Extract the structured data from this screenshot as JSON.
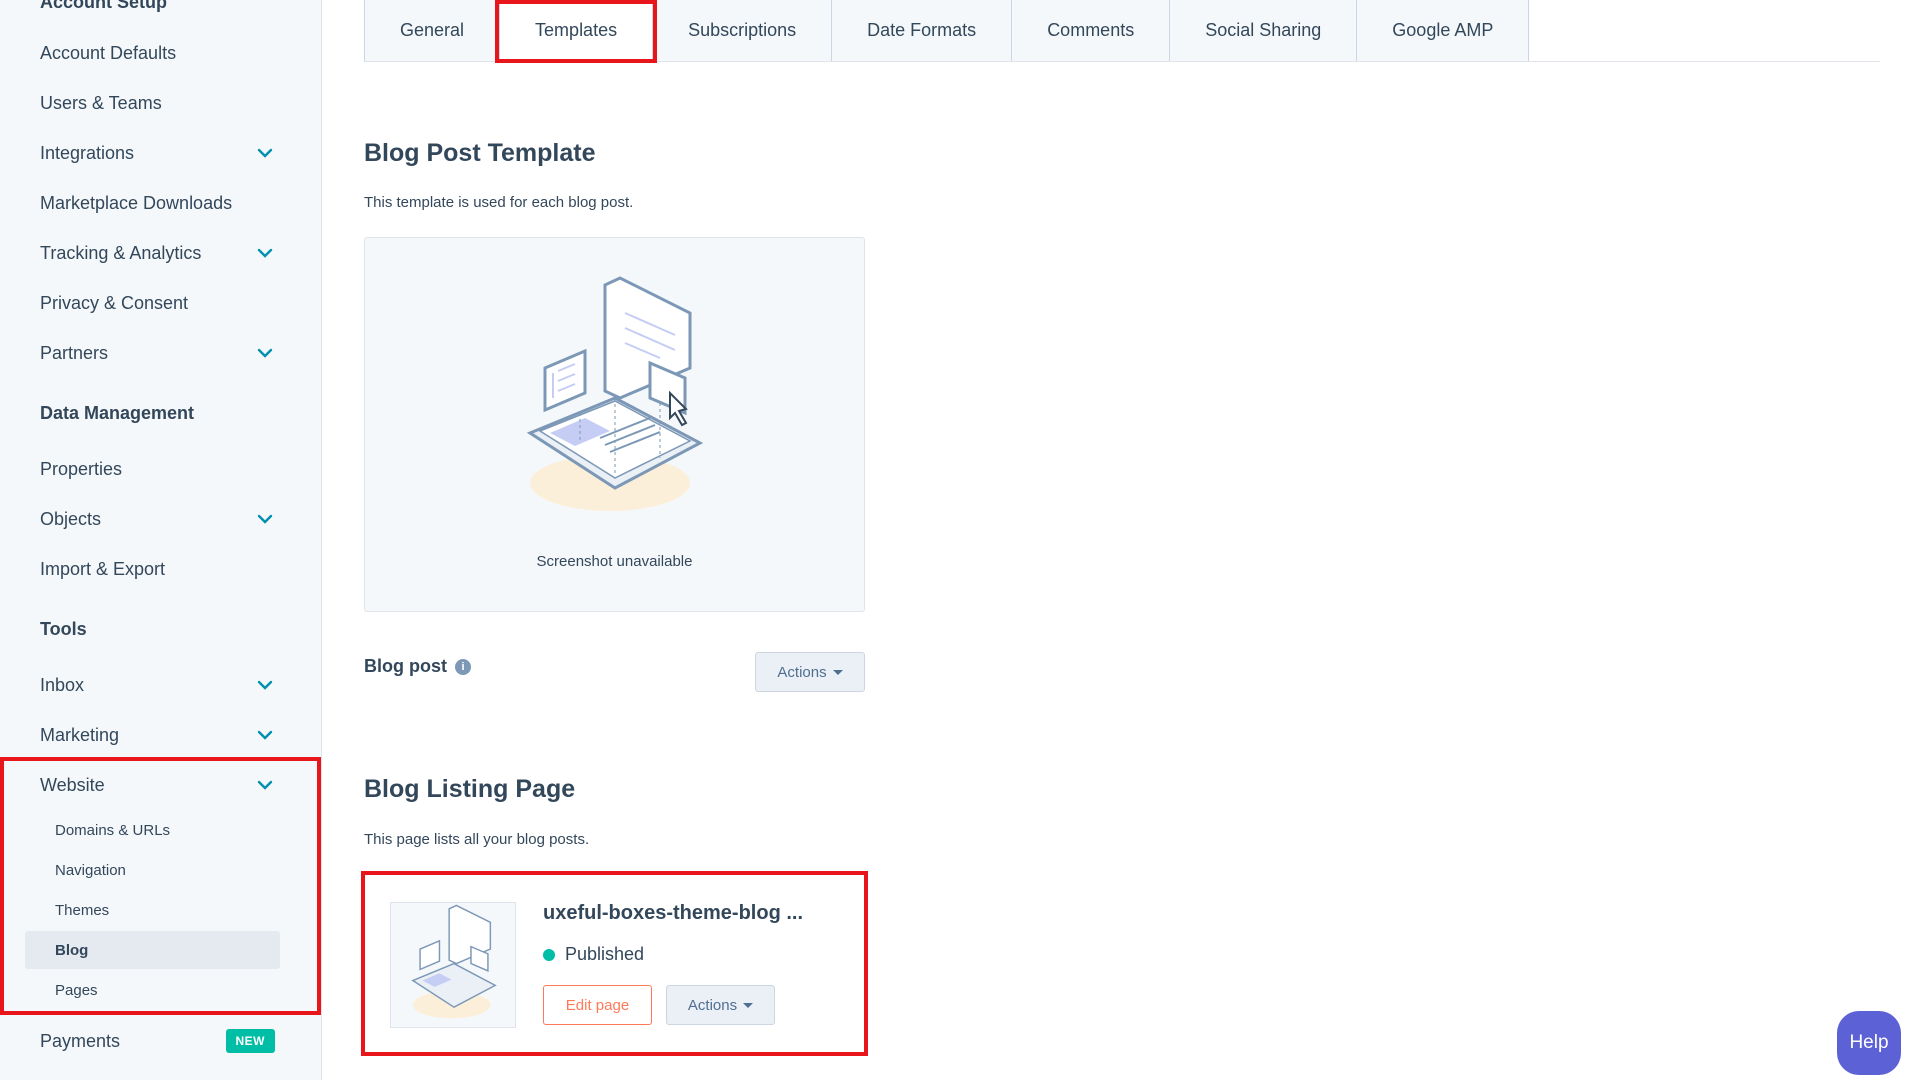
{
  "sidebar": {
    "account_setup_heading": "Account Setup",
    "items": [
      {
        "label": "Account Defaults"
      },
      {
        "label": "Users & Teams"
      },
      {
        "label": "Integrations"
      },
      {
        "label": "Marketplace Downloads"
      },
      {
        "label": "Tracking & Analytics"
      },
      {
        "label": "Privacy & Consent"
      },
      {
        "label": "Partners"
      }
    ],
    "data_management_heading": "Data Management",
    "data_items": [
      {
        "label": "Properties"
      },
      {
        "label": "Objects"
      },
      {
        "label": "Import & Export"
      }
    ],
    "tools_heading": "Tools",
    "tools_items": [
      {
        "label": "Inbox"
      },
      {
        "label": "Marketing"
      },
      {
        "label": "Website"
      }
    ],
    "website_sub": [
      {
        "label": "Domains & URLs"
      },
      {
        "label": "Navigation"
      },
      {
        "label": "Themes"
      },
      {
        "label": "Blog"
      },
      {
        "label": "Pages"
      }
    ],
    "payments_label": "Payments",
    "payments_badge": "NEW"
  },
  "tabs": [
    {
      "label": "General"
    },
    {
      "label": "Templates"
    },
    {
      "label": "Subscriptions"
    },
    {
      "label": "Date Formats"
    },
    {
      "label": "Comments"
    },
    {
      "label": "Social Sharing"
    },
    {
      "label": "Google AMP"
    }
  ],
  "blog_post_template": {
    "title": "Blog Post Template",
    "description": "This template is used for each blog post.",
    "preview_caption": "Screenshot unavailable",
    "field_label": "Blog post",
    "actions_label": "Actions"
  },
  "blog_listing": {
    "title": "Blog Listing Page",
    "description": "This page lists all your blog posts.",
    "card_title": "uxeful-boxes-theme-blog ...",
    "status": "Published",
    "edit_label": "Edit page",
    "actions_label": "Actions"
  },
  "help_label": "Help",
  "colors": {
    "accent": "#ff7a59",
    "success": "#00bda5",
    "highlight": "#e8151b",
    "help": "#5c62d6"
  }
}
